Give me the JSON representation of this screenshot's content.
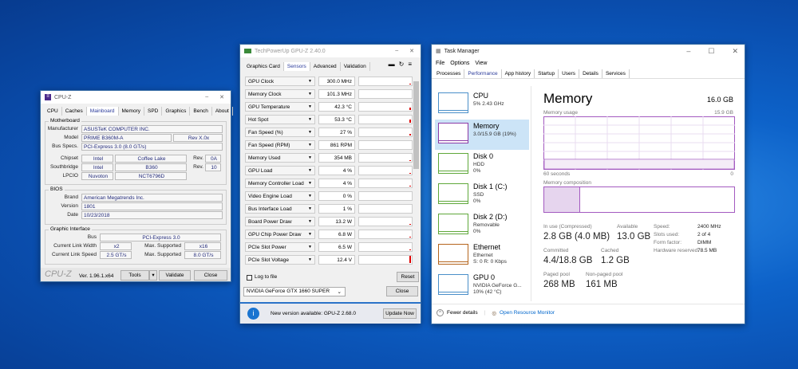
{
  "cpuz": {
    "title": "CPU-Z",
    "tabs": [
      "CPU",
      "Caches",
      "Mainboard",
      "Memory",
      "SPD",
      "Graphics",
      "Bench",
      "About"
    ],
    "active_tab": "Mainboard",
    "motherboard": {
      "group": "Motherboard",
      "manufacturer_label": "Manufacturer",
      "manufacturer": "ASUSTeK COMPUTER INC.",
      "model_label": "Model",
      "model": "PRIME B360M-A",
      "rev": "Rev X.0x",
      "bus_label": "Bus Specs.",
      "bus": "PCI-Express 3.0 (8.0 GT/s)",
      "chipset_label": "Chipset",
      "chipset_vendor": "Intel",
      "chipset_name": "Coffee Lake",
      "rev_label": "Rev.",
      "chipset_rev": "0A",
      "sb_label": "Southbridge",
      "sb_vendor": "Intel",
      "sb_name": "B360",
      "sb_rev": "10",
      "lpcio_label": "LPCIO",
      "lpcio_vendor": "Nuvoton",
      "lpcio_name": "NCT6796D"
    },
    "bios": {
      "group": "BIOS",
      "brand_label": "Brand",
      "brand": "American Megatrends Inc.",
      "version_label": "Version",
      "version": "1801",
      "date_label": "Date",
      "date": "10/23/2018"
    },
    "gi": {
      "group": "Graphic Interface",
      "bus_label": "Bus",
      "bus": "PCI-Express 3.0",
      "width_label": "Current Link Width",
      "width": "x2",
      "max_label": "Max. Supported",
      "max_width": "x16",
      "speed_label": "Current Link Speed",
      "speed": "2.5 GT/s",
      "max_speed": "8.0 GT/s"
    },
    "footer": {
      "logo": "CPU-Z",
      "version": "Ver. 1.96.1.x64",
      "tools": "Tools",
      "validate": "Validate",
      "close": "Close"
    }
  },
  "gpuz": {
    "title": "TechPowerUp GPU-Z 2.40.0",
    "tabs": [
      "Graphics Card",
      "Sensors",
      "Advanced",
      "Validation"
    ],
    "active_tab": "Sensors",
    "sensors": [
      {
        "name": "GPU Clock",
        "value": "300.0 MHz",
        "level": 0.05
      },
      {
        "name": "Memory Clock",
        "value": "101.3 MHz",
        "level": 0
      },
      {
        "name": "GPU Temperature",
        "value": "42.3 °C",
        "level": 0.3
      },
      {
        "name": "Hot Spot",
        "value": "53.3 °C",
        "level": 0.4
      },
      {
        "name": "Fan Speed (%)",
        "value": "27 %",
        "level": 0.25
      },
      {
        "name": "Fan Speed (RPM)",
        "value": "861 RPM",
        "level": 0
      },
      {
        "name": "Memory Used",
        "value": "354 MB",
        "level": 0.05
      },
      {
        "name": "GPU Load",
        "value": "4 %",
        "level": 0.05
      },
      {
        "name": "Memory Controller Load",
        "value": "4 %",
        "level": 0.05
      },
      {
        "name": "Video Engine Load",
        "value": "0 %",
        "level": 0
      },
      {
        "name": "Bus Interface Load",
        "value": "1 %",
        "level": 0
      },
      {
        "name": "Board Power Draw",
        "value": "13.2 W",
        "level": 0.1
      },
      {
        "name": "GPU Chip Power Draw",
        "value": "6.8 W",
        "level": 0.05
      },
      {
        "name": "PCIe Slot Power",
        "value": "6.5 W",
        "level": 0.05
      },
      {
        "name": "PCIe Slot Voltage",
        "value": "12.4 V",
        "level": 0.9
      }
    ],
    "log_label": "Log to file",
    "reset": "Reset",
    "device": "NVIDIA GeForce GTX 1660 SUPER",
    "close": "Close",
    "update_msg": "New version available: GPU-Z 2.68.0",
    "update_btn": "Update Now"
  },
  "taskmgr": {
    "title": "Task Manager",
    "menu": [
      "File",
      "Options",
      "View"
    ],
    "tabs": [
      "Processes",
      "Performance",
      "App history",
      "Startup",
      "Users",
      "Details",
      "Services"
    ],
    "active_tab": "Performance",
    "side": [
      {
        "name": "CPU",
        "sub1": "5% 2.43 GHz",
        "sub2": "",
        "color": "#4a8fc9"
      },
      {
        "name": "Memory",
        "sub1": "3.0/15.9 GB (19%)",
        "sub2": "",
        "color": "#8b3aa6"
      },
      {
        "name": "Disk 0",
        "sub1": "HDD",
        "sub2": "0%",
        "color": "#5fa83a"
      },
      {
        "name": "Disk 1 (C:)",
        "sub1": "SSD",
        "sub2": "0%",
        "color": "#5fa83a"
      },
      {
        "name": "Disk 2 (D:)",
        "sub1": "Removable",
        "sub2": "0%",
        "color": "#5fa83a"
      },
      {
        "name": "Ethernet",
        "sub1": "Ethernet",
        "sub2": "S: 0 R: 0 Kbps",
        "color": "#b5651d"
      },
      {
        "name": "GPU 0",
        "sub1": "NVIDIA GeForce G...",
        "sub2": "10% (42 °C)",
        "color": "#4a8fc9"
      }
    ],
    "main": {
      "title": "Memory",
      "total": "16.0 GB",
      "usage_label": "Memory usage",
      "usage_max": "15.9 GB",
      "time_label": "60 seconds",
      "time_end": "0",
      "composition_label": "Memory composition",
      "in_use_fraction": 0.19,
      "in_use_label": "In use (Compressed)",
      "in_use": "2.8 GB (4.0 MB)",
      "available_label": "Available",
      "available": "13.0 GB",
      "committed_label": "Committed",
      "committed": "4.4/18.8 GB",
      "cached_label": "Cached",
      "cached": "1.2 GB",
      "paged_label": "Paged pool",
      "paged": "268 MB",
      "nonpaged_label": "Non-paged pool",
      "nonpaged": "161 MB",
      "speed_label": "Speed:",
      "speed": "2400 MHz",
      "slots_label": "Slots used:",
      "slots": "2 of 4",
      "form_label": "Form factor:",
      "form": "DIMM",
      "hw_label": "Hardware reserved:",
      "hw": "78.5 MB"
    },
    "fewer": "Fewer details",
    "resmon": "Open Resource Monitor"
  }
}
